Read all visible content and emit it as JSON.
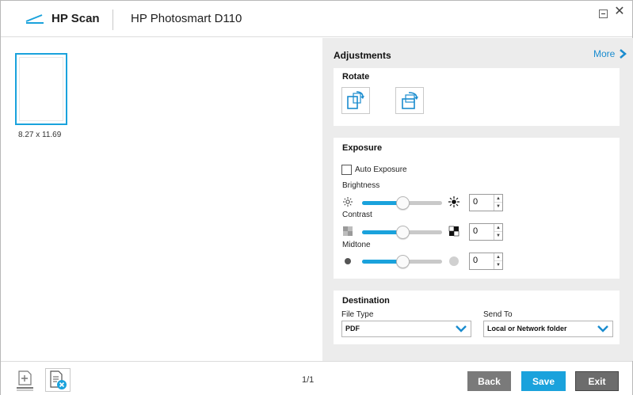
{
  "titlebar": {
    "app_name": "HP Scan",
    "device_name": "HP Photosmart D110",
    "minimize_icon": "minimize-icon",
    "close_symbol": "✕"
  },
  "preview": {
    "page_size": "8.27  x  11.69"
  },
  "panel": {
    "heading": "Adjustments",
    "more_label": "More",
    "accent": "#1aa2dc",
    "rotate": {
      "title": "Rotate",
      "left_icon": "rotate-left-icon",
      "right_icon": "rotate-right-icon"
    },
    "exposure": {
      "title": "Exposure",
      "auto_label": "Auto Exposure",
      "auto_checked": false,
      "brightness": {
        "label": "Brightness",
        "value": "0",
        "level": 0.5
      },
      "contrast": {
        "label": "Contrast",
        "value": "0",
        "level": 0.5
      },
      "midtone": {
        "label": "Midtone",
        "value": "0",
        "level": 0.5
      }
    },
    "destination": {
      "title": "Destination",
      "file_type_label": "File Type",
      "file_type_value": "PDF",
      "send_to_label": "Send To",
      "send_to_value": "Local or Network folder"
    }
  },
  "bottom": {
    "page_count": "1/1",
    "back_label": "Back",
    "save_label": "Save",
    "exit_label": "Exit"
  }
}
